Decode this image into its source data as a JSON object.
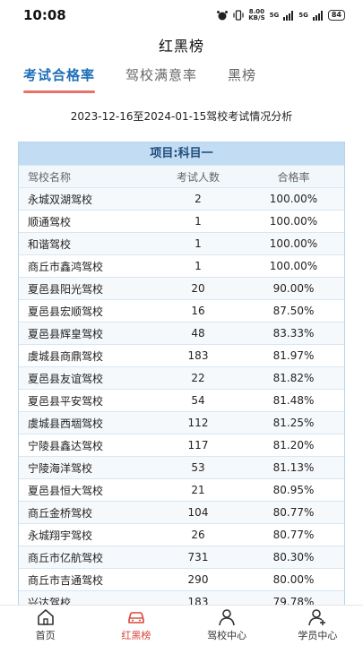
{
  "status": {
    "time": "10:08",
    "net_speed_value": "8.00",
    "net_speed_unit": "KB/S",
    "signal1": "5G",
    "signal2": "5G",
    "battery": "84"
  },
  "header": {
    "title": "红黑榜"
  },
  "tabs": [
    {
      "label": "考试合格率"
    },
    {
      "label": "驾校满意率"
    },
    {
      "label": "黑榜"
    }
  ],
  "subtitle": "2023-12-16至2024-01-15驾校考试情况分析",
  "table": {
    "title": "项目:科目一",
    "columns": [
      "驾校名称",
      "考试人数",
      "合格率"
    ],
    "rows": [
      {
        "name": "永城双湖驾校",
        "count": "2",
        "rate": "100.00%"
      },
      {
        "name": "顺通驾校",
        "count": "1",
        "rate": "100.00%"
      },
      {
        "name": "和谐驾校",
        "count": "1",
        "rate": "100.00%"
      },
      {
        "name": "商丘市鑫鸿驾校",
        "count": "1",
        "rate": "100.00%"
      },
      {
        "name": "夏邑县阳光驾校",
        "count": "20",
        "rate": "90.00%"
      },
      {
        "name": "夏邑县宏顺驾校",
        "count": "16",
        "rate": "87.50%"
      },
      {
        "name": "夏邑县辉皇驾校",
        "count": "48",
        "rate": "83.33%"
      },
      {
        "name": "虞城县商鼎驾校",
        "count": "183",
        "rate": "81.97%"
      },
      {
        "name": "夏邑县友谊驾校",
        "count": "22",
        "rate": "81.82%"
      },
      {
        "name": "夏邑县平安驾校",
        "count": "54",
        "rate": "81.48%"
      },
      {
        "name": "虞城县西堌驾校",
        "count": "112",
        "rate": "81.25%"
      },
      {
        "name": "宁陵县鑫达驾校",
        "count": "117",
        "rate": "81.20%"
      },
      {
        "name": "宁陵海洋驾校",
        "count": "53",
        "rate": "81.13%"
      },
      {
        "name": "夏邑县恒大驾校",
        "count": "21",
        "rate": "80.95%"
      },
      {
        "name": "商丘金桥驾校",
        "count": "104",
        "rate": "80.77%"
      },
      {
        "name": "永城翔宇驾校",
        "count": "26",
        "rate": "80.77%"
      },
      {
        "name": "商丘市亿航驾校",
        "count": "731",
        "rate": "80.30%"
      },
      {
        "name": "商丘市吉通驾校",
        "count": "290",
        "rate": "80.00%"
      },
      {
        "name": "兴达驾校",
        "count": "183",
        "rate": "79.78%"
      }
    ]
  },
  "bottom_nav": [
    {
      "label": "首页",
      "icon": "home-icon"
    },
    {
      "label": "红黑榜",
      "icon": "car-icon"
    },
    {
      "label": "驾校中心",
      "icon": "school-user-icon"
    },
    {
      "label": "学员中心",
      "icon": "student-user-icon"
    }
  ],
  "colors": {
    "accent": "#1d6fb8",
    "tab_underline": "#e8726a",
    "active_nav": "#d9463c",
    "table_header_bg": "#c2dcf3"
  }
}
